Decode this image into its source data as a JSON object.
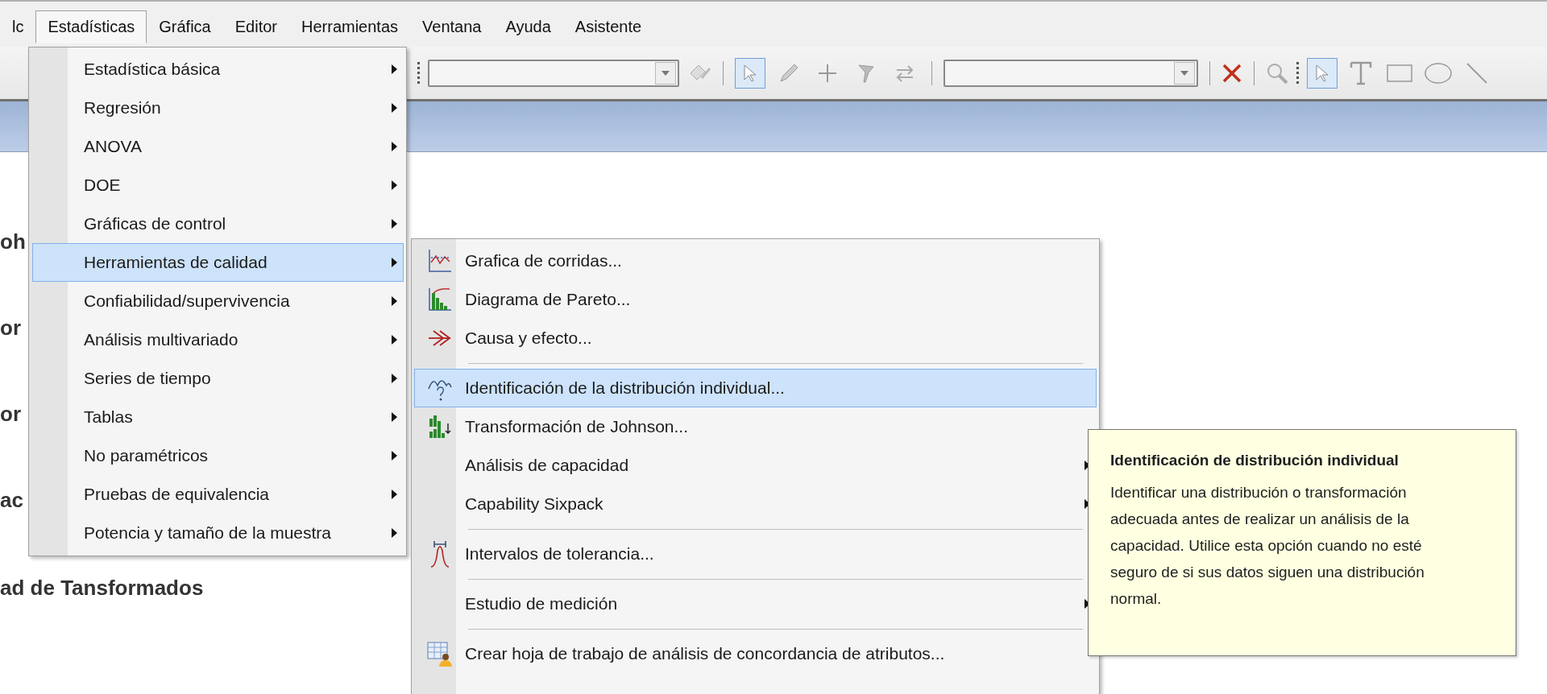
{
  "menubar": {
    "items": [
      {
        "label": "lc",
        "selected": false
      },
      {
        "label": "Estadísticas",
        "selected": true
      },
      {
        "label": "Gráfica",
        "selected": false
      },
      {
        "label": "Editor",
        "selected": false
      },
      {
        "label": "Herramientas",
        "selected": false
      },
      {
        "label": "Ventana",
        "selected": false
      },
      {
        "label": "Ayuda",
        "selected": false
      },
      {
        "label": "Asistente",
        "selected": false
      }
    ]
  },
  "toolbar": {
    "edit_tools": [
      {
        "selected": true
      },
      {
        "selected": false
      },
      {
        "selected": false
      },
      {
        "selected": false
      },
      {
        "selected": false
      }
    ],
    "draw_tools": [
      {
        "selected": true
      },
      {
        "selected": false
      },
      {
        "selected": false
      },
      {
        "selected": false
      },
      {
        "selected": false
      }
    ]
  },
  "document": {
    "headings": [
      "oh",
      "or",
      "or",
      "ac",
      "ad de Tansformados"
    ]
  },
  "menu": {
    "items": [
      {
        "label": "Estadística básica",
        "has_submenu": true,
        "selected": false
      },
      {
        "label": "Regresión",
        "has_submenu": true,
        "selected": false
      },
      {
        "label": "ANOVA",
        "has_submenu": true,
        "selected": false
      },
      {
        "label": "DOE",
        "has_submenu": true,
        "selected": false
      },
      {
        "label": "Gráficas de control",
        "has_submenu": true,
        "selected": false
      },
      {
        "label": "Herramientas de calidad",
        "has_submenu": true,
        "selected": true
      },
      {
        "label": "Confiabilidad/supervivencia",
        "has_submenu": true,
        "selected": false
      },
      {
        "label": "Análisis multivariado",
        "has_submenu": true,
        "selected": false
      },
      {
        "label": "Series de tiempo",
        "has_submenu": true,
        "selected": false
      },
      {
        "label": "Tablas",
        "has_submenu": true,
        "selected": false
      },
      {
        "label": "No paramétricos",
        "has_submenu": true,
        "selected": false
      },
      {
        "label": "Pruebas de equivalencia",
        "has_submenu": true,
        "selected": false
      },
      {
        "label": "Potencia y tamaño de la muestra",
        "has_submenu": true,
        "selected": false
      }
    ]
  },
  "submenu": {
    "items": [
      {
        "kind": "item",
        "label": "Grafica de corridas...",
        "has_submenu": false,
        "selected": false
      },
      {
        "kind": "item",
        "label": "Diagrama de Pareto...",
        "has_submenu": false,
        "selected": false
      },
      {
        "kind": "item",
        "label": "Causa y efecto...",
        "has_submenu": false,
        "selected": false
      },
      {
        "kind": "separator"
      },
      {
        "kind": "item",
        "label": "Identificación de la distribución individual...",
        "has_submenu": false,
        "selected": true
      },
      {
        "kind": "item",
        "label": "Transformación de Johnson...",
        "has_submenu": false,
        "selected": false
      },
      {
        "kind": "item",
        "label": "Análisis de capacidad",
        "has_submenu": true,
        "selected": false
      },
      {
        "kind": "item",
        "label": "Capability Sixpack",
        "has_submenu": true,
        "selected": false
      },
      {
        "kind": "separator"
      },
      {
        "kind": "item",
        "label": "Intervalos de tolerancia...",
        "has_submenu": false,
        "selected": false
      },
      {
        "kind": "separator"
      },
      {
        "kind": "item",
        "label": "Estudio de medición",
        "has_submenu": true,
        "selected": false
      },
      {
        "kind": "separator"
      },
      {
        "kind": "item",
        "label": "Crear hoja de trabajo de análisis de concordancia de atributos...",
        "has_submenu": false,
        "selected": false
      }
    ]
  },
  "tooltip": {
    "title": "Identificación de distribución individual",
    "body": "Identificar una distribución o transformación adecuada antes de realizar un análisis de la capacidad. Utilice esta opción cuando no esté seguro de si sus datos siguen una distribución normal."
  }
}
